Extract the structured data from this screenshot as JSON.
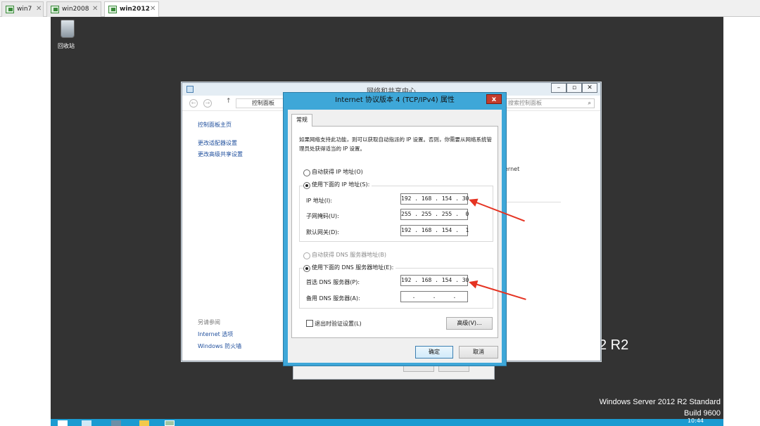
{
  "host_tabs": [
    {
      "label": "win7"
    },
    {
      "label": "win2008"
    },
    {
      "label": "win2012"
    }
  ],
  "desktop": {
    "recycle_bin_label": "回收站",
    "watermark_fragment": "2 R2",
    "edition_line1": "Windows Server 2012 R2 Standard",
    "edition_line2": "Build 9600",
    "clock": "10:44"
  },
  "network_window": {
    "title": "网络和共享中心",
    "breadcrumb": "控制面板",
    "search_placeholder": "搜索控制面板",
    "left_links": [
      "控制面板主页",
      "更改适配器设置",
      "更改高级共享设置"
    ],
    "see_also_header": "另请参阅",
    "see_also_links": [
      "Internet 选项",
      "Windows 防火墙"
    ],
    "fragment_text": "ernet"
  },
  "tcp_dialog": {
    "title": "Internet 协议版本 4 (TCP/IPv4) 属性",
    "close_label": "x",
    "tab_label": "常规",
    "description": "如果网络支持此功能，则可以获取自动指派的 IP 设置。否则，你需要从网络系统管理员处获得适当的 IP 设置。",
    "ip_auto_label": "自动获得 IP 地址(O)",
    "ip_manual_label": "使用下面的 IP 地址(S):",
    "ip_address_label": "IP 地址(I):",
    "ip_address_value": "192 . 168 . 154 . 30",
    "subnet_label": "子网掩码(U):",
    "subnet_value": "255 . 255 . 255 .  0",
    "gateway_label": "默认网关(D):",
    "gateway_value": "192 . 168 . 154 .  1",
    "dns_auto_label": "自动获得 DNS 服务器地址(B)",
    "dns_manual_label": "使用下面的 DNS 服务器地址(E):",
    "preferred_dns_label": "首选 DNS 服务器(P):",
    "preferred_dns_value": "192 . 168 . 154 . 30",
    "alternate_dns_label": "备用 DNS 服务器(A):",
    "alternate_dns_value": "   .     .     .   ",
    "validate_label": "退出时验证设置(L)",
    "advanced_label": "高级(V)...",
    "ok_label": "确定",
    "cancel_label": "取消"
  },
  "colors": {
    "desktop_bg": "#333333",
    "dialog_frame": "#3ea7d8",
    "close_red": "#c43c2c",
    "arrow_red": "#e53322",
    "taskbar": "#1b9bd1"
  }
}
